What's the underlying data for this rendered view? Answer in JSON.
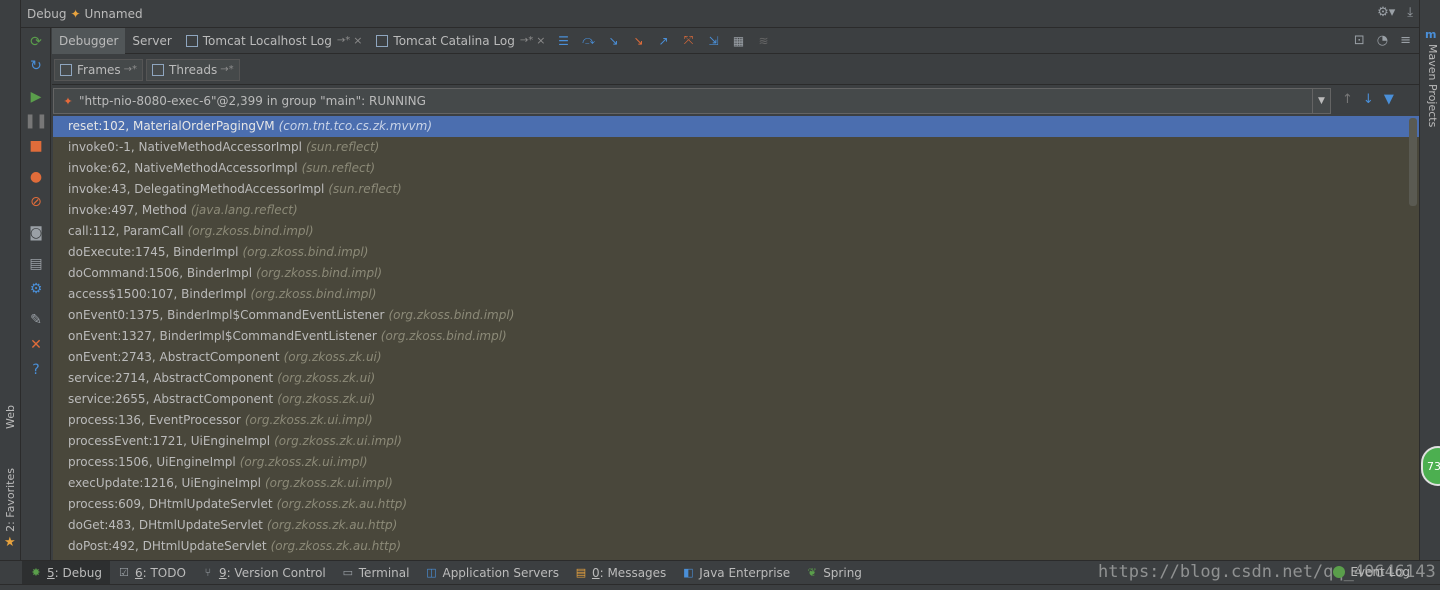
{
  "window": {
    "title_prefix": "Debug",
    "config_name": "Unnamed",
    "right_icons": [
      "gear-icon",
      "hide-icon"
    ]
  },
  "left_strip": {
    "web_label": "Web",
    "favorites_label": "2: Favorites"
  },
  "right_strip": {
    "maven_label": "Maven Projects"
  },
  "tabs": [
    {
      "label": "Debugger",
      "active": true
    },
    {
      "label": "Server",
      "active": false
    },
    {
      "label": "Tomcat Localhost Log",
      "active": false,
      "pin": "→*",
      "close": "×"
    },
    {
      "label": "Tomcat Catalina Log",
      "active": false,
      "pin": "→*",
      "close": "×"
    }
  ],
  "subtabs": [
    {
      "label": "Frames",
      "pin": "→*"
    },
    {
      "label": "Threads",
      "pin": "→*"
    }
  ],
  "thread": {
    "label": "\"http-nio-8080-exec-6\"@2,399 in group \"main\": RUNNING"
  },
  "frames": [
    {
      "method": "reset:102, MaterialOrderPagingVM",
      "pkg": "(com.tnt.tco.cs.zk.mvvm)",
      "selected": true
    },
    {
      "method": "invoke0:-1, NativeMethodAccessorImpl",
      "pkg": "(sun.reflect)"
    },
    {
      "method": "invoke:62, NativeMethodAccessorImpl",
      "pkg": "(sun.reflect)"
    },
    {
      "method": "invoke:43, DelegatingMethodAccessorImpl",
      "pkg": "(sun.reflect)"
    },
    {
      "method": "invoke:497, Method",
      "pkg": "(java.lang.reflect)"
    },
    {
      "method": "call:112, ParamCall",
      "pkg": "(org.zkoss.bind.impl)"
    },
    {
      "method": "doExecute:1745, BinderImpl",
      "pkg": "(org.zkoss.bind.impl)"
    },
    {
      "method": "doCommand:1506, BinderImpl",
      "pkg": "(org.zkoss.bind.impl)"
    },
    {
      "method": "access$1500:107, BinderImpl",
      "pkg": "(org.zkoss.bind.impl)"
    },
    {
      "method": "onEvent0:1375, BinderImpl$CommandEventListener",
      "pkg": "(org.zkoss.bind.impl)"
    },
    {
      "method": "onEvent:1327, BinderImpl$CommandEventListener",
      "pkg": "(org.zkoss.bind.impl)"
    },
    {
      "method": "onEvent:2743, AbstractComponent",
      "pkg": "(org.zkoss.zk.ui)"
    },
    {
      "method": "service:2714, AbstractComponent",
      "pkg": "(org.zkoss.zk.ui)"
    },
    {
      "method": "service:2655, AbstractComponent",
      "pkg": "(org.zkoss.zk.ui)"
    },
    {
      "method": "process:136, EventProcessor",
      "pkg": "(org.zkoss.zk.ui.impl)"
    },
    {
      "method": "processEvent:1721, UiEngineImpl",
      "pkg": "(org.zkoss.zk.ui.impl)"
    },
    {
      "method": "process:1506, UiEngineImpl",
      "pkg": "(org.zkoss.zk.ui.impl)"
    },
    {
      "method": "execUpdate:1216, UiEngineImpl",
      "pkg": "(org.zkoss.zk.ui.impl)"
    },
    {
      "method": "process:609, DHtmlUpdateServlet",
      "pkg": "(org.zkoss.zk.au.http)"
    },
    {
      "method": "doGet:483, DHtmlUpdateServlet",
      "pkg": "(org.zkoss.zk.au.http)"
    },
    {
      "method": "doPost:492, DHtmlUpdateServlet",
      "pkg": "(org.zkoss.zk.au.http)"
    }
  ],
  "statusbar": [
    {
      "num": "5",
      "label": ": Debug",
      "icon": "bug-icon",
      "active": true
    },
    {
      "num": "6",
      "label": ": TODO",
      "icon": "todo-icon"
    },
    {
      "num": "9",
      "label": ": Version Control",
      "icon": "vcs-icon"
    },
    {
      "num": "",
      "label": "Terminal",
      "icon": "terminal-icon"
    },
    {
      "num": "",
      "label": "Application Servers",
      "icon": "servers-icon"
    },
    {
      "num": "0",
      "label": ": Messages",
      "icon": "messages-icon"
    },
    {
      "num": "",
      "label": "Java Enterprise",
      "icon": "java-ee-icon"
    },
    {
      "num": "",
      "label": "Spring",
      "icon": "spring-icon"
    }
  ],
  "watermark": "https://blog.csdn.net/qq_40646143",
  "event_log": "Event Log",
  "badge": "73",
  "colors": {
    "background": "#3c3f41",
    "frames_bg": "#49473b",
    "selection": "#4b6eaf",
    "accent_green": "#5a9e4b",
    "accent_orange": "#e8a33e"
  }
}
